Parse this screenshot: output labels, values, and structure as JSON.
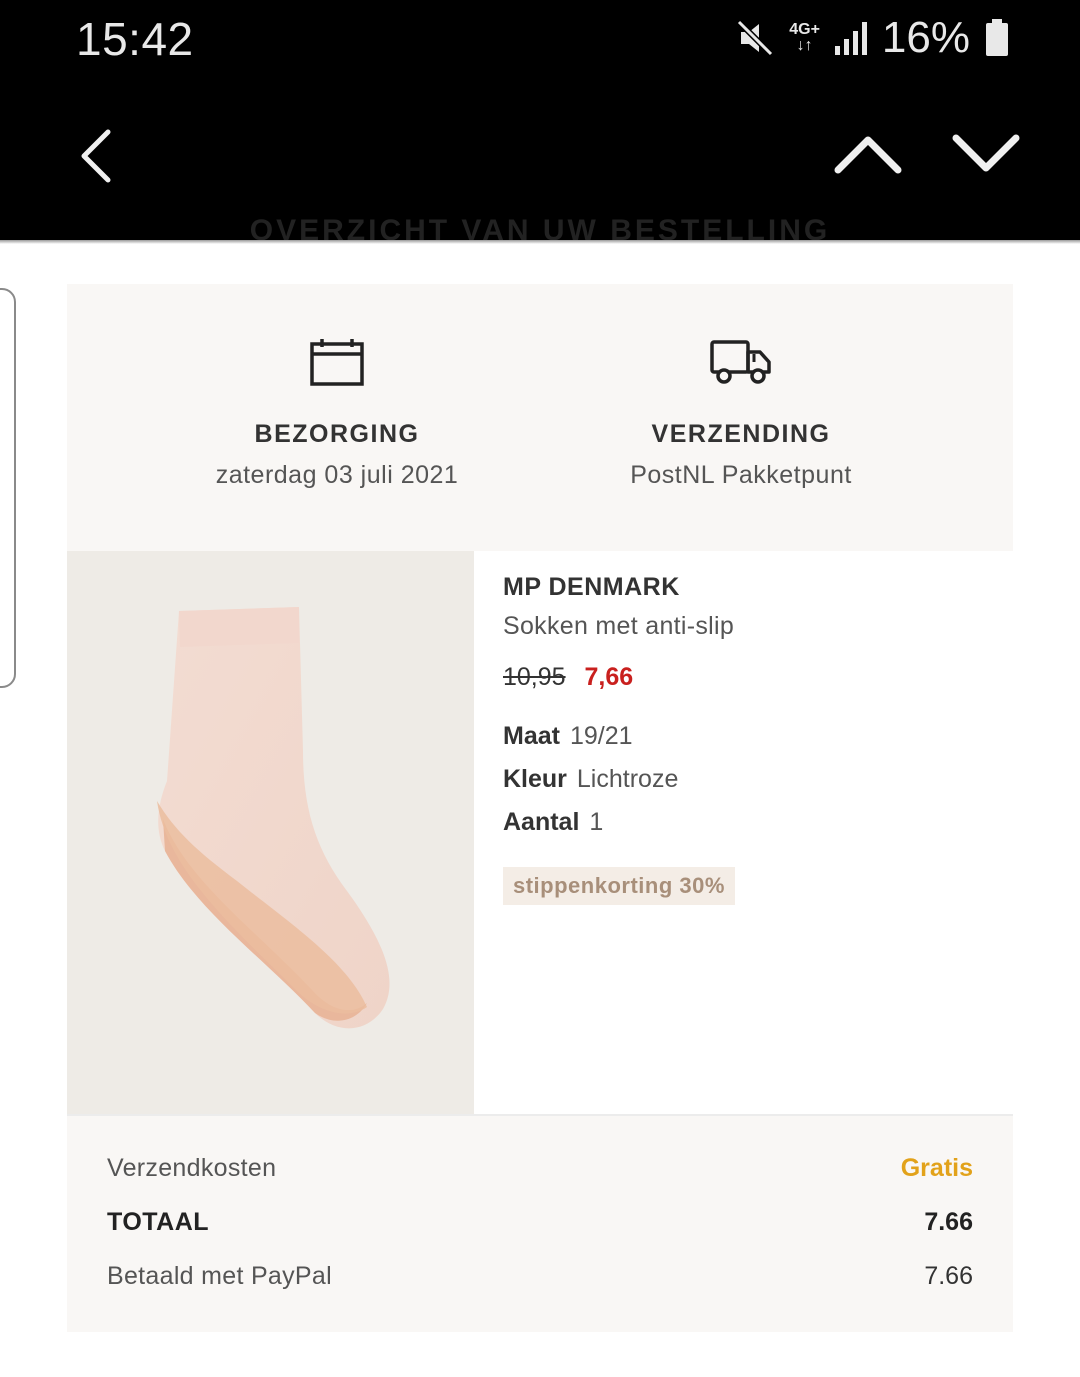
{
  "status_bar": {
    "time": "15:42",
    "network": "4G+",
    "battery": "16%",
    "icons": [
      "mute-icon",
      "signal-icon",
      "battery-icon"
    ]
  },
  "header": {
    "section_title": "OVERZICHT VAN UW BESTELLING",
    "icons": [
      "back-arrow-icon",
      "chevron-up-icon",
      "chevron-down-icon"
    ]
  },
  "delivery": {
    "bezorging": {
      "title": "BEZORGING",
      "value": "zaterdag 03 juli 2021",
      "icon": "calendar-icon"
    },
    "verzending": {
      "title": "VERZENDING",
      "value": "PostNL Pakketpunt",
      "icon": "truck-icon"
    }
  },
  "product": {
    "brand": "MP DENMARK",
    "name": "Sokken met anti-slip",
    "old_price": "10,95",
    "new_price": "7,66",
    "size_label": "Maat",
    "size_value": "19/21",
    "color_label": "Kleur",
    "color_value": "Lichtroze",
    "qty_label": "Aantal",
    "qty_value": "1",
    "badge": "stippenkorting 30%"
  },
  "totals": {
    "shipping_label": "Verzendkosten",
    "shipping_value": "Gratis",
    "total_label": "TOTAAL",
    "total_value": "7.66",
    "paid_label": "Betaald met PayPal",
    "paid_value": "7.66"
  },
  "colors": {
    "header_bg": "#000000",
    "panel_bg": "#f9f7f5",
    "sale_price": "#c9201e",
    "free_shipping": "#e2a21a",
    "badge_bg": "#f4ede6",
    "badge_text": "#a88f7a"
  }
}
